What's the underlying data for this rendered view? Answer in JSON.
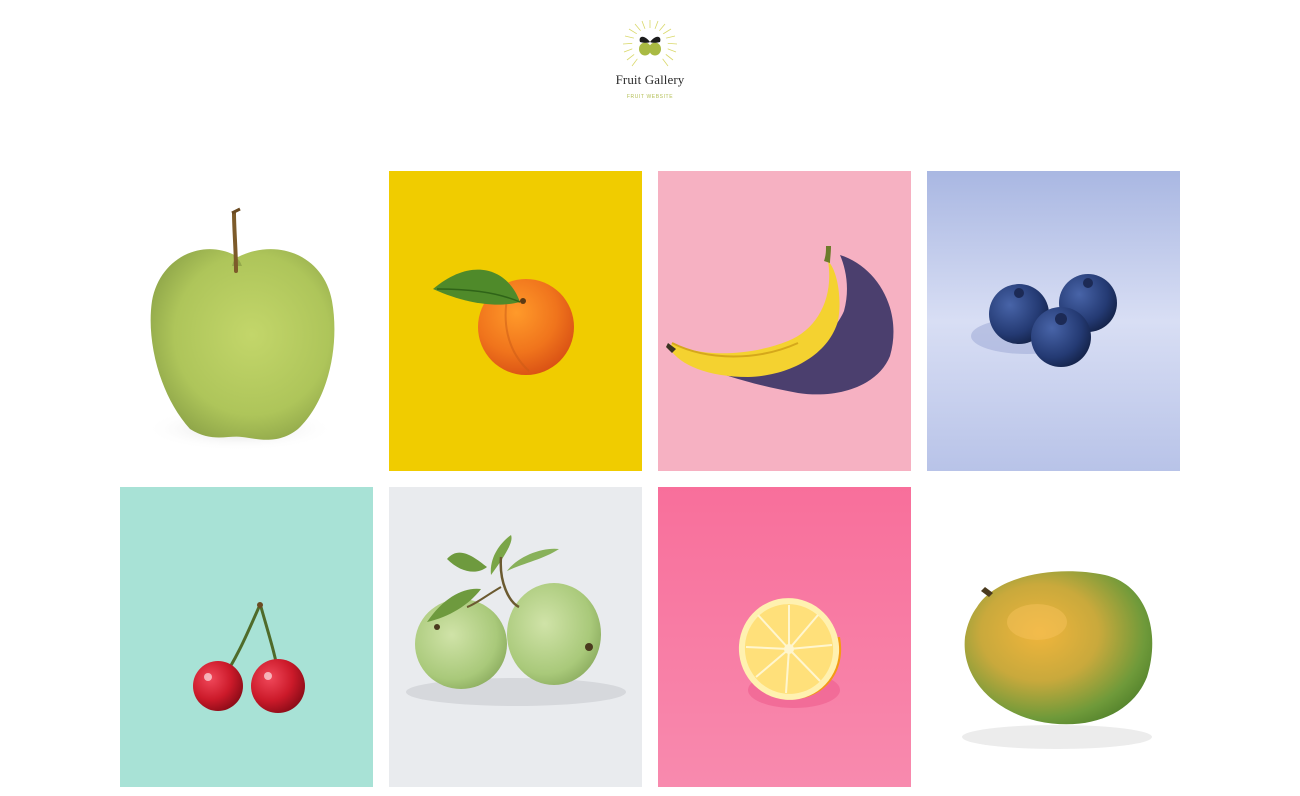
{
  "header": {
    "logo_title": "Fruit Gallery",
    "logo_subtitle": "FRUIT WEBSITE",
    "logo_icon": "leaf-fruit-icon",
    "accent_color": "#a9ba43"
  },
  "gallery": {
    "items": [
      {
        "fruit": "apple",
        "icon": "green-apple-photo",
        "background": "#ffffff"
      },
      {
        "fruit": "apricot",
        "icon": "apricot-photo",
        "background": "#f0cc00"
      },
      {
        "fruit": "banana",
        "icon": "banana-photo",
        "background": "#f6b1c2"
      },
      {
        "fruit": "blueberry",
        "icon": "blueberry-photo",
        "background": "#c6d0ec"
      },
      {
        "fruit": "cherry",
        "icon": "cherry-photo",
        "background": "#a8e2d6"
      },
      {
        "fruit": "guava",
        "icon": "guava-photo",
        "background": "#e9ebee"
      },
      {
        "fruit": "lemon",
        "icon": "lemon-photo",
        "background": "#f77aa4"
      },
      {
        "fruit": "mango",
        "icon": "mango-photo",
        "background": "#ffffff"
      }
    ]
  }
}
